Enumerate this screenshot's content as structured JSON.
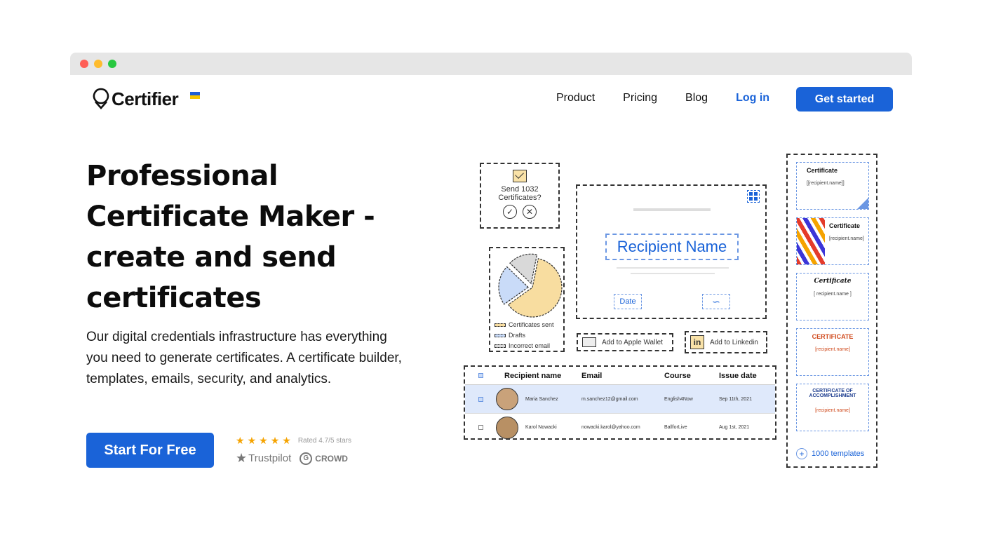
{
  "brand": {
    "name": "Certifier",
    "primary_color": "#1a63d8",
    "flag_colors": [
      "#1f5fd6",
      "#f7c600"
    ]
  },
  "nav": {
    "links": [
      "Product",
      "Pricing",
      "Blog"
    ],
    "login": "Log in",
    "cta": "Get started"
  },
  "hero": {
    "title_lines": [
      "Professional",
      "Certificate Maker -",
      "create and send",
      "certificates"
    ],
    "description": "Our digital credentials infrastructure has everything you need to generate certificates. A certificate builder, templates, emails, security, and analytics.",
    "cta": "Start For Free",
    "rating_text": "Rated 4.7/5 stars",
    "review_sites": [
      "Trustpilot",
      "CROWD"
    ],
    "g2_letter": "G"
  },
  "illustration": {
    "send_prompt": "Send 1032 Certificates?",
    "pie_legend": [
      "Certificates sent",
      "Drafts",
      "Incorrect email"
    ],
    "pie_chart": {
      "slices": [
        62,
        22,
        16
      ],
      "colors": [
        "#f8dda0",
        "#c9dbf8",
        "#d9d9d9"
      ]
    },
    "certificate": {
      "recipient_placeholder": "Recipient Name",
      "date_placeholder": "Date"
    },
    "wallet_button": "Add to Apple Wallet",
    "linkedin_button": "Add to Linkedin",
    "linkedin_icon_text": "in",
    "table": {
      "headers": [
        "Recipient name",
        "Email",
        "Course",
        "Issue date"
      ],
      "rows": [
        {
          "name": "Maria Sanchez",
          "email": "m.sanchez12@gmail.com",
          "course": "English4Now",
          "date": "Sep 11th, 2021",
          "selected": true
        },
        {
          "name": "Karol Nowacki",
          "email": "nowacki.karol@yahoo.com",
          "course": "BallforLive",
          "date": "Aug 1st, 2021",
          "selected": false
        }
      ]
    },
    "templates": {
      "items": [
        {
          "title": "Certificate",
          "subtitle": "[[recipient.name]]"
        },
        {
          "title": "Certificate",
          "subtitle": "[recipient.name]"
        },
        {
          "title": "Certificate",
          "subtitle": "[ recipient.name ]"
        },
        {
          "title": "CERTIFICATE",
          "subtitle": "[recipient.name]"
        },
        {
          "title": "CERTIFICATE OF ACCOMPLISHMENT",
          "subtitle": "[recipient.name]"
        }
      ],
      "more_label": "1000 templates"
    }
  }
}
